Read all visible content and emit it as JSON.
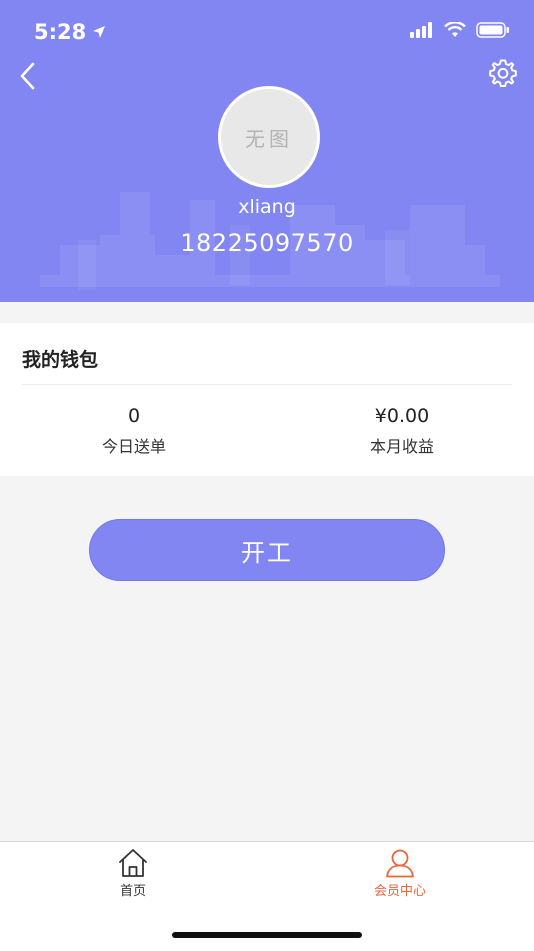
{
  "status_bar": {
    "time": "5:28"
  },
  "header": {
    "avatar_text": "无图",
    "username": "xliang",
    "phone": "18225097570"
  },
  "wallet": {
    "title": "我的钱包",
    "today_orders_value": "0",
    "today_orders_label": "今日送单",
    "month_income_value": "¥0.00",
    "month_income_label": "本月收益"
  },
  "actions": {
    "start_label": "开工"
  },
  "tabbar": {
    "items": [
      {
        "label": "首页",
        "icon": "home-icon",
        "active": false
      },
      {
        "label": "会员中心",
        "icon": "user-icon",
        "active": true
      }
    ]
  },
  "colors": {
    "accent": "#8186f2",
    "active_tab": "#e8663a",
    "inactive_tab": "#333333"
  }
}
